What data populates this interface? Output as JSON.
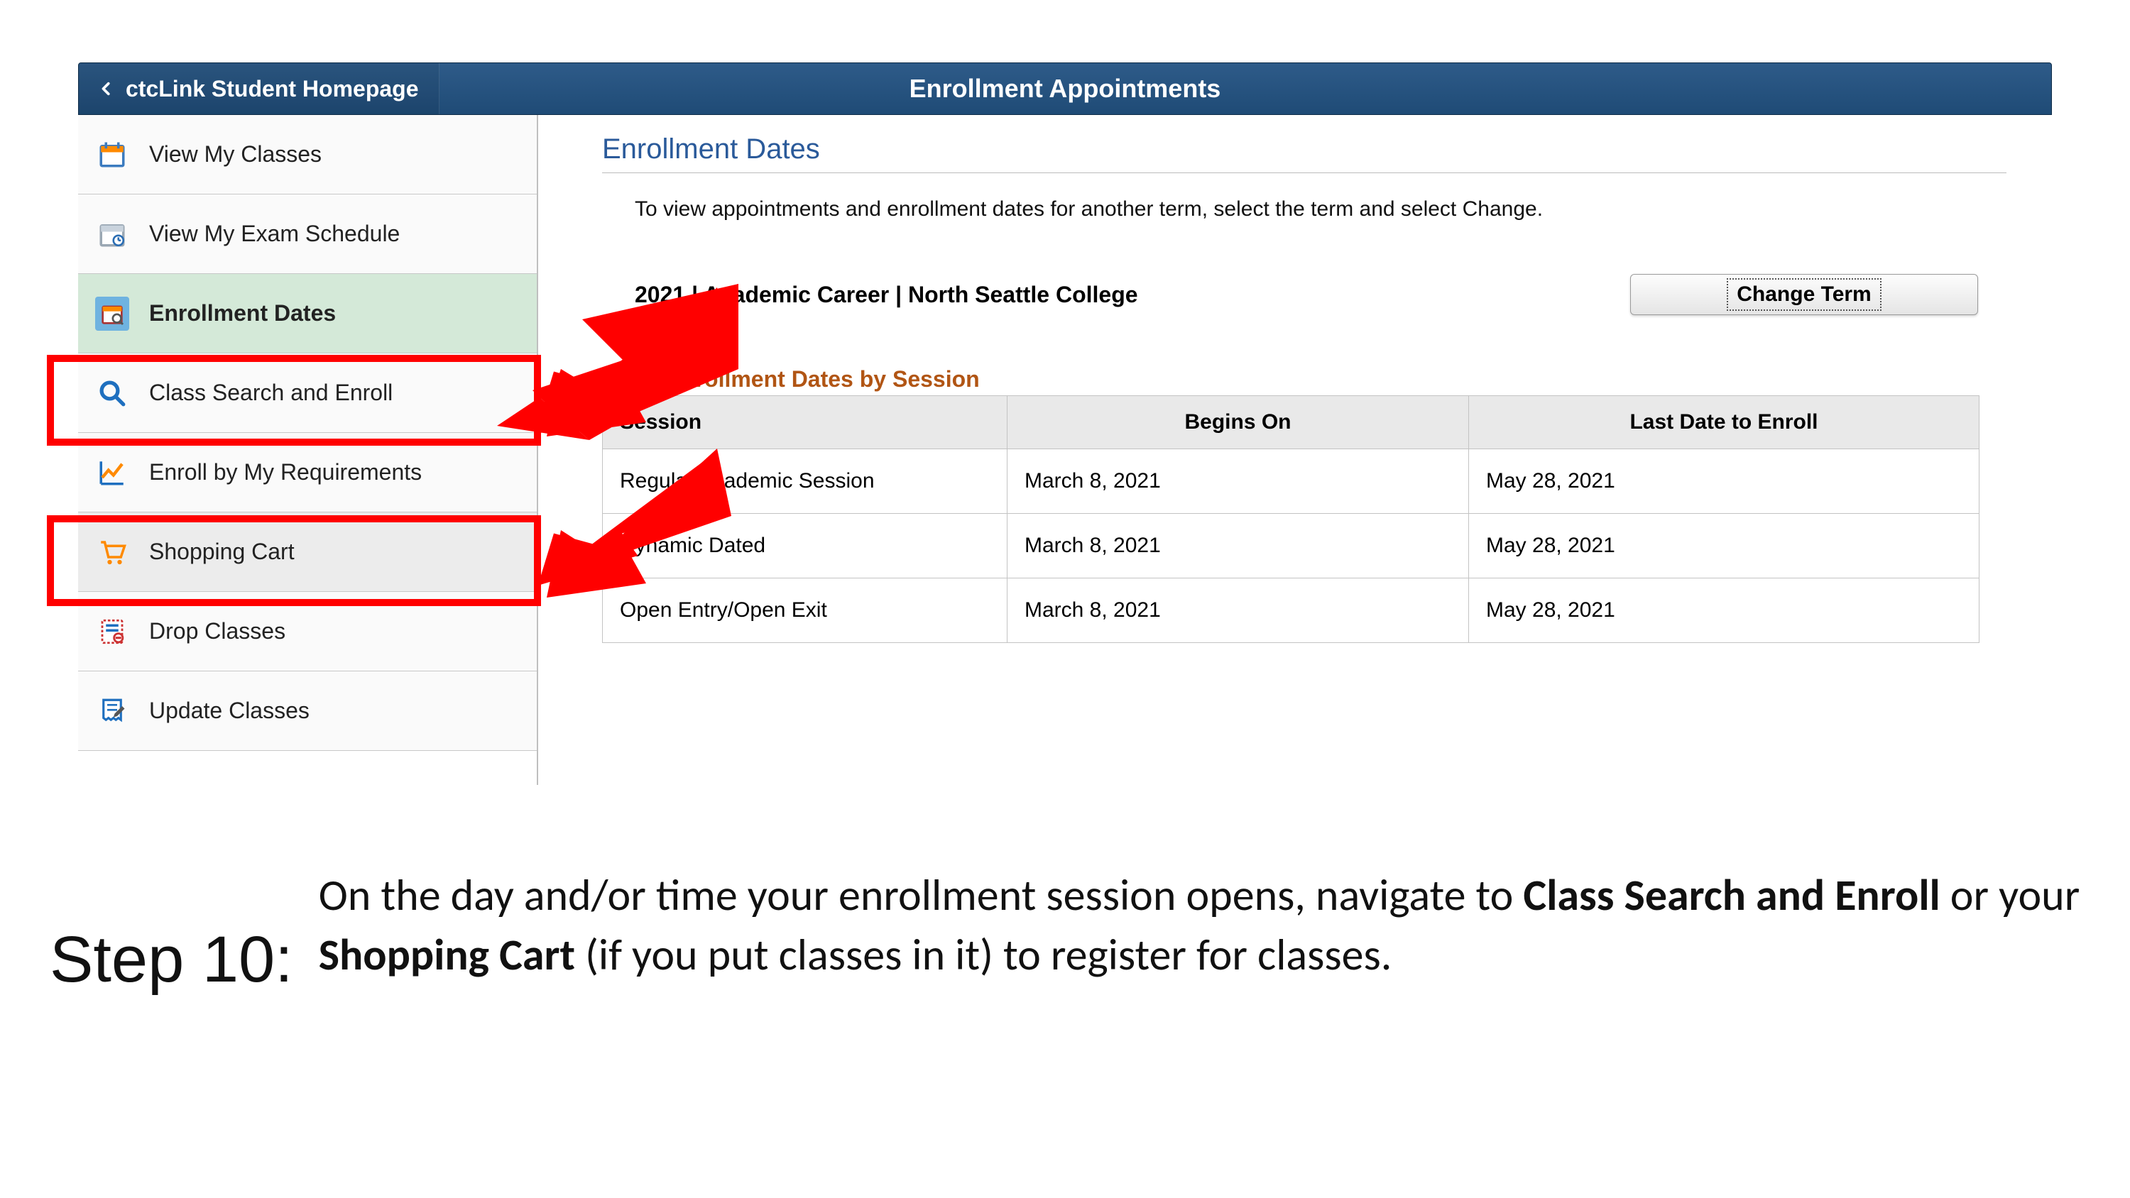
{
  "header": {
    "back_label": "ctcLink Student Homepage",
    "title": "Enrollment Appointments"
  },
  "sidebar": {
    "items": [
      {
        "label": "View My Classes"
      },
      {
        "label": "View My Exam Schedule"
      },
      {
        "label": "Enrollment Dates"
      },
      {
        "label": "Class Search and Enroll"
      },
      {
        "label": "Enroll by My Requirements"
      },
      {
        "label": "Shopping Cart"
      },
      {
        "label": "Drop Classes"
      },
      {
        "label": "Update Classes"
      }
    ]
  },
  "main": {
    "section_heading": "Enrollment Dates",
    "instruction": "To view appointments and enrollment dates for another term, select the term and select Change.",
    "term_year": "2021",
    "term_rest": " | Academic Career | North Seattle College",
    "change_btn": "Change Term",
    "table_heading": "Open Enrollment Dates by Session",
    "cols": {
      "c1": "Session",
      "c2": "Begins On",
      "c3": "Last Date to Enroll"
    },
    "rows": [
      {
        "session": "Regular Academic Session",
        "begins": "March 8, 2021",
        "last": "May 28, 2021"
      },
      {
        "session": "Dynamic Dated",
        "begins": "March 8, 2021",
        "last": "May 28, 2021"
      },
      {
        "session": "Open Entry/Open Exit",
        "begins": "March 8, 2021",
        "last": "May 28, 2021"
      }
    ]
  },
  "caption": {
    "step": "Step 10:",
    "before1": "On the day and/or time your enrollment session opens, navigate to ",
    "bold1": "Class Search and Enroll",
    "mid": " or your ",
    "bold2": "Shopping Cart",
    "after": " (if you put classes in it) to register for classes."
  }
}
